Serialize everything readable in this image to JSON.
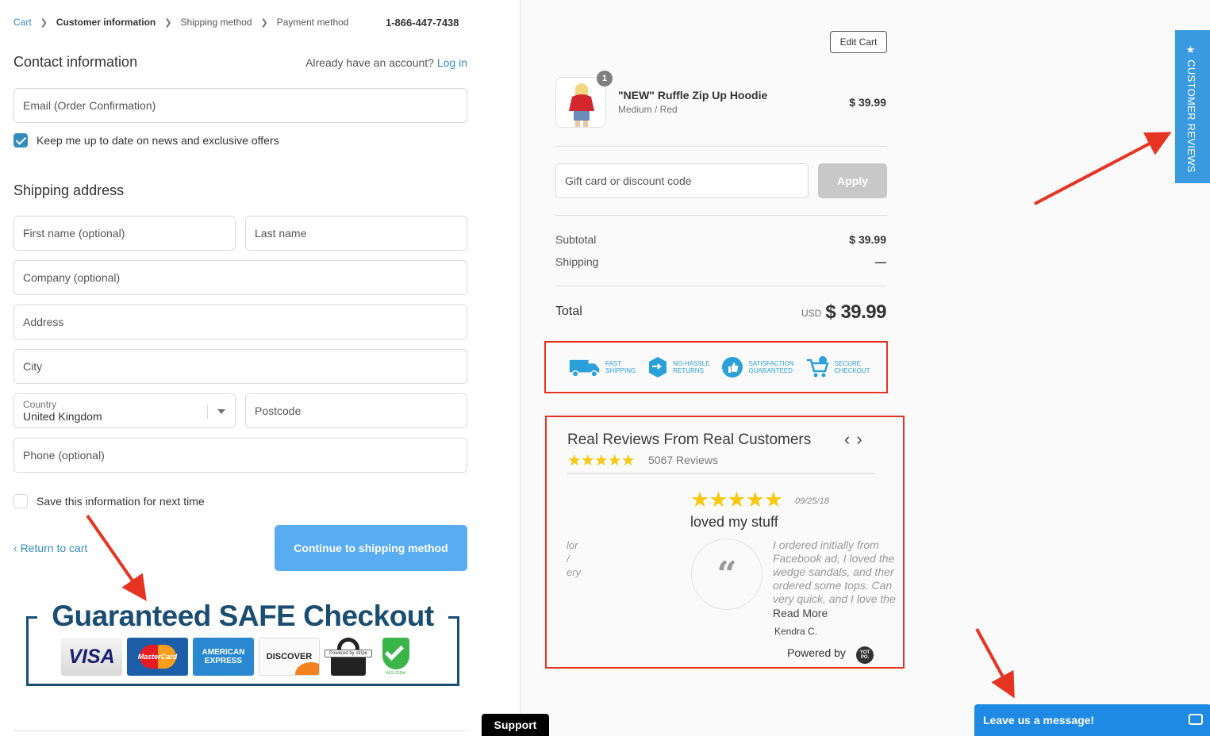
{
  "breadcrumb": [
    "Cart",
    "Customer information",
    "Shipping method",
    "Payment method"
  ],
  "phone": "1-866-447-7438",
  "contact": {
    "title": "Contact information",
    "account_prompt": "Already have an account?",
    "login_link": "Log in",
    "email_placeholder": "Email (Order Confirmation)",
    "newsletter_label": "Keep me up to date on news and exclusive offers",
    "newsletter_checked": true
  },
  "shipping": {
    "title": "Shipping address",
    "first_name": "First name (optional)",
    "last_name": "Last name",
    "company": "Company (optional)",
    "address": "Address",
    "city": "City",
    "country_label": "Country",
    "country_value": "United Kingdom",
    "postcode": "Postcode",
    "phone": "Phone (optional)",
    "save_label": "Save this information for next time",
    "save_checked": false
  },
  "actions": {
    "return_label": "Return to cart",
    "continue_label": "Continue to shipping method"
  },
  "safe_checkout": {
    "title": "Guaranteed SAFE Checkout",
    "cards": [
      "VISA",
      "MasterCard",
      "AMERICAN EXPRESS",
      "DISCOVER",
      "Powered by stripe",
      "AES-256bit"
    ]
  },
  "support_label": "Support",
  "order": {
    "edit_cart": "Edit Cart",
    "item": {
      "qty": "1",
      "name": "\"NEW\" Ruffle Zip Up Hoodie",
      "variant": "Medium / Red",
      "price": "$ 39.99"
    },
    "discount_placeholder": "Gift card or discount code",
    "apply_label": "Apply",
    "subtotal_label": "Subtotal",
    "subtotal_value": "$ 39.99",
    "shipping_label": "Shipping",
    "shipping_value": "—",
    "total_label": "Total",
    "currency": "USD",
    "total_value": "$ 39.99"
  },
  "trust_badges": [
    {
      "l1": "FAST",
      "l2": "SHIPPING",
      "icon": "truck-icon"
    },
    {
      "l1": "NO-HASSLE",
      "l2": "RETURNS",
      "icon": "box-icon"
    },
    {
      "l1": "SATISFACTION",
      "l2": "GUARANTEED",
      "icon": "thumbs-up-icon"
    },
    {
      "l1": "SECURE",
      "l2": "CHECKOUT",
      "icon": "cart-icon"
    }
  ],
  "reviews": {
    "title": "Real Reviews From Real Customers",
    "count": "5067 Reviews",
    "date": "09/25/18",
    "review_title": "loved my stuff",
    "side_text": [
      "lor",
      "/",
      "ery"
    ],
    "body": [
      "I ordered initially from",
      "Facebook ad, I loved the",
      "wedge sandals, and ther",
      "ordered some tops. Can",
      "very quick, and I love the"
    ],
    "read_more": "Read More",
    "author": "Kendra C.",
    "powered_by": "Powered by",
    "yotpo": "YOT PO."
  },
  "side_tab": "CUSTOMER REVIEWS",
  "chat_label": "Leave us a message!",
  "colors": {
    "accent": "#338dbc",
    "button": "#5aacf2",
    "annotation": "#e53522",
    "navy": "#1b4d73",
    "star": "#f6c80f"
  }
}
